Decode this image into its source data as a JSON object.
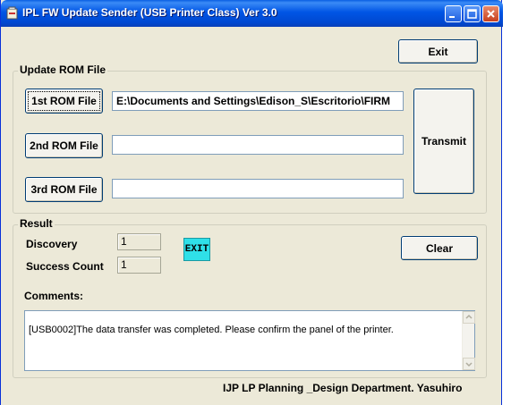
{
  "window": {
    "title": "IPL FW Update Sender (USB Printer Class)  Ver 3.0",
    "title_color": "#0055e5"
  },
  "header": {
    "exit_label": "Exit"
  },
  "update_rom": {
    "group_label": "Update ROM File",
    "first_button": "1st ROM File",
    "first_path": "E:\\Documents and Settings\\Edison_S\\Escritorio\\FIRM",
    "second_button": "2nd ROM File",
    "second_path": "",
    "third_button": "3rd ROM File",
    "third_path": "",
    "transmit_label": "Transmit"
  },
  "result": {
    "group_label": "Result",
    "discovery_label": "Discovery",
    "discovery_value": "1",
    "success_label": "Success Count",
    "success_value": "1",
    "exit_badge": "EXIT",
    "exit_badge_color": "#2fe0e8",
    "clear_label": "Clear",
    "comments_label": "Comments:",
    "comments_text": "[USB0002]The data transfer was completed. Please confirm the panel of the printer."
  },
  "footer": {
    "text": "IJP LP Planning _Design Department.  Yasuhiro"
  }
}
